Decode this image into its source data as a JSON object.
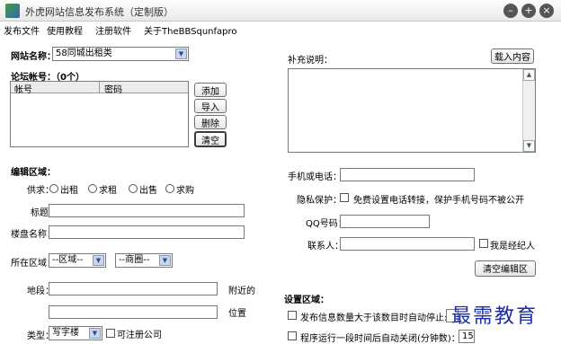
{
  "window": {
    "title": "外虎网站信息发布系统（定制版）",
    "minimize_glyph": "–",
    "maximize_glyph": "+",
    "close_glyph": "×"
  },
  "menu": [
    "发布文件",
    "使用教程",
    "注册软件",
    "关于TheBBSqunfapro"
  ],
  "site": {
    "label": "网站名称：",
    "selected": "58同城出租类"
  },
  "forum": {
    "label": "论坛帐号：（0个）",
    "columns": [
      "帐号",
      "密码"
    ],
    "buttons": {
      "add": "添加",
      "import": "导入",
      "delete": "删除",
      "clear": "清空"
    }
  },
  "notes": {
    "label": "补充说明：",
    "load_button": "载入内容"
  },
  "edit": {
    "section": "编辑区域：",
    "supply_label": "供求：",
    "supply_options": [
      "出租",
      "求租",
      "出售",
      "求购"
    ],
    "title_label": "标题：",
    "building_label": "楼盘名称：",
    "region_label": "所在区域：",
    "district_select": "--区域--",
    "zone_select": "--商圈--",
    "address_label": "地段：",
    "address_suffix": "附近的",
    "location_suffix": "位置",
    "type_label": "类型：",
    "type_select": "写字楼",
    "company_check": "可注册公司"
  },
  "contact": {
    "phone_label": "手机或电话：",
    "privacy_label": "隐私保护：",
    "privacy_text": "免费设置电话转接，保护手机号码不被公开",
    "qq_label": "QQ号码：",
    "contact_label": "联系人：",
    "agent_check": "我是经纪人",
    "clear_button": "清空编辑区"
  },
  "settings": {
    "section": "设置区域：",
    "auto_stop_text": "发布信息数量大于该数目时自动停止:",
    "auto_close_text": "程序运行一段时间后自动关闭(分钟数)：",
    "auto_close_value": "15"
  },
  "watermark": "最需教育"
}
